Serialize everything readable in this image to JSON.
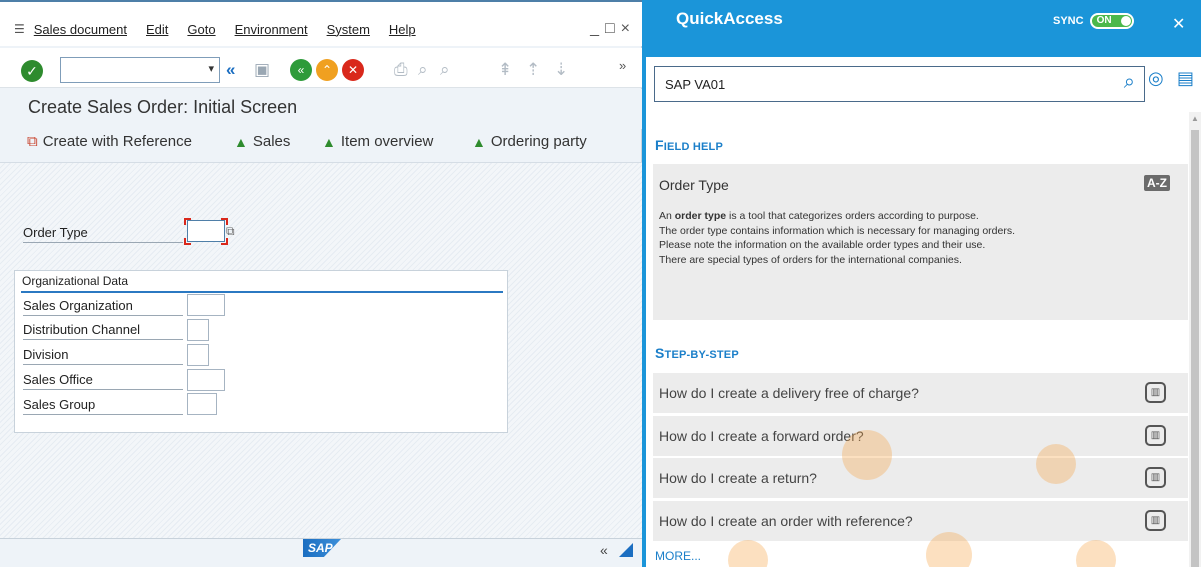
{
  "sap": {
    "menu": [
      "Sales document",
      "Edit",
      "Goto",
      "Environment",
      "System",
      "Help"
    ],
    "window_controls": [
      "_",
      "□",
      "×"
    ],
    "title": "Create Sales Order: Initial Screen",
    "app_toolbar": {
      "create_with_reference": "Create with Reference",
      "sales": "Sales",
      "item_overview": "Item overview",
      "ordering_party": "Ordering party"
    },
    "order_type": {
      "label": "Order Type",
      "value": ""
    },
    "org_data": {
      "header": "Organizational Data",
      "fields": [
        {
          "label": "Sales Organization",
          "value": ""
        },
        {
          "label": "Distribution Channel",
          "value": ""
        },
        {
          "label": "Division",
          "value": ""
        },
        {
          "label": "Sales Office",
          "value": ""
        },
        {
          "label": "Sales Group",
          "value": ""
        }
      ]
    },
    "status_logo": "SAP",
    "status_arrows": "«"
  },
  "quickaccess": {
    "title": "QuickAccess",
    "sync_label": "SYNC",
    "sync_state": "ON",
    "search_value": "SAP VA01",
    "field_help": {
      "section_first": "F",
      "section_rest": "IELD HELP",
      "title": "Order Type",
      "badge": "A-Z",
      "p_before": "An ",
      "p_bold": "order type",
      "p_after": " is a tool that categorizes orders according to purpose.",
      "lines": [
        "The order type contains information which is necessary for managing orders.",
        "Please note the information on the available order types and their use.",
        "There are special types of orders for the international companies."
      ]
    },
    "step_by_step": {
      "section_first": "S",
      "section_rest": "TEP-BY-STEP",
      "items": [
        "How do I create a delivery free of charge?",
        "How do I create a forward order?",
        "How do I create a return?",
        "How do I create an order with reference?"
      ]
    },
    "more": "MORE..."
  }
}
